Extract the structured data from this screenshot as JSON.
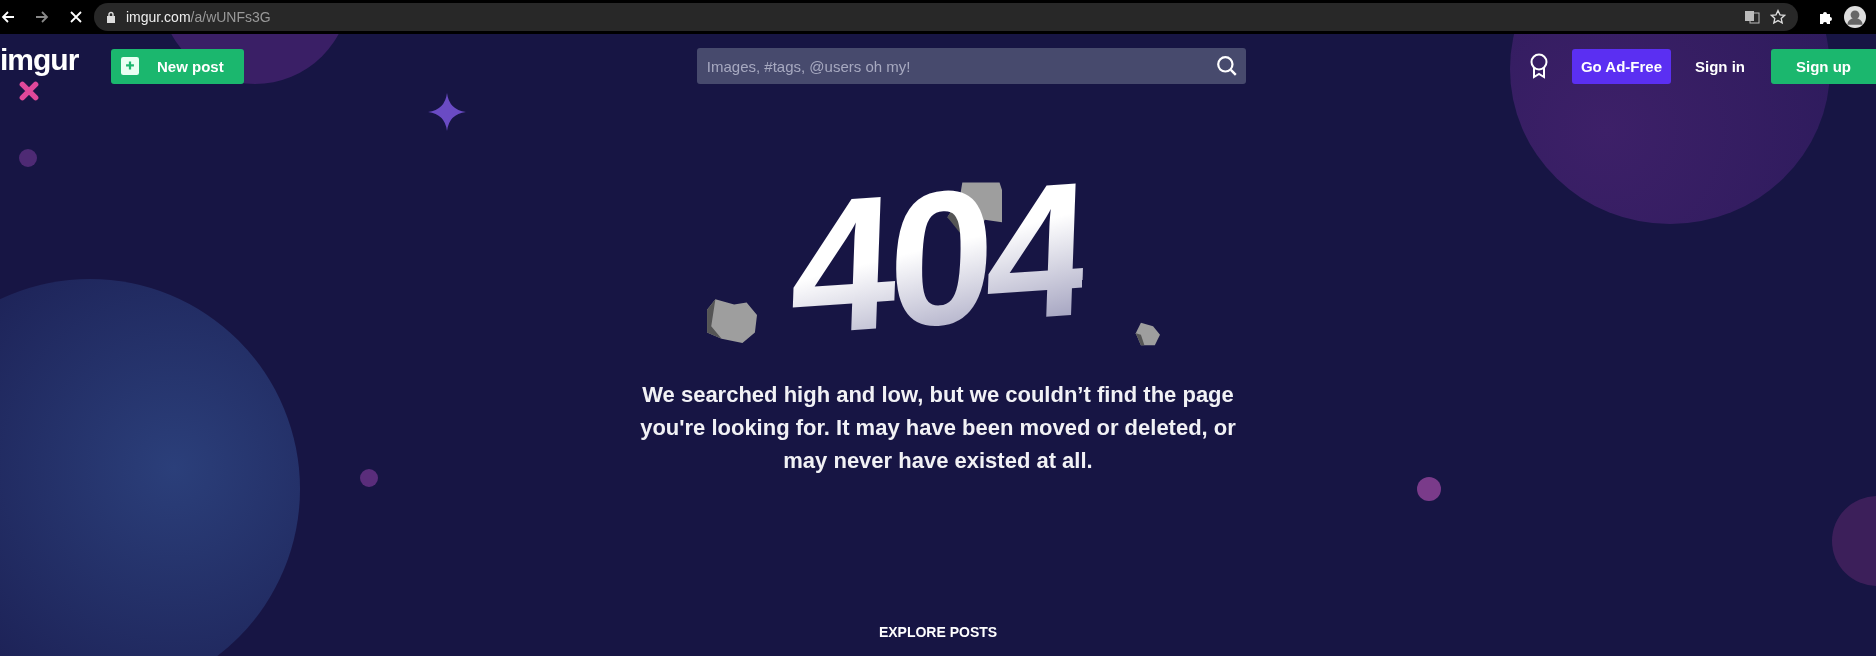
{
  "browser": {
    "url_host": "imgur.com",
    "url_path": "/a/wUNFs3G"
  },
  "header": {
    "logo": "imgur",
    "new_post": "New post",
    "search": {
      "placeholder": "Images, #tags, @users oh my!"
    },
    "go_ad_free": "Go Ad-Free",
    "sign_in": "Sign in",
    "sign_up": "Sign up"
  },
  "error": {
    "code": "404",
    "message": "We searched high and low, but we couldn’t find the page you're looking for. It may have been moved or deleted, or may never have existed at all."
  },
  "explore": "EXPLORE POSTS"
}
